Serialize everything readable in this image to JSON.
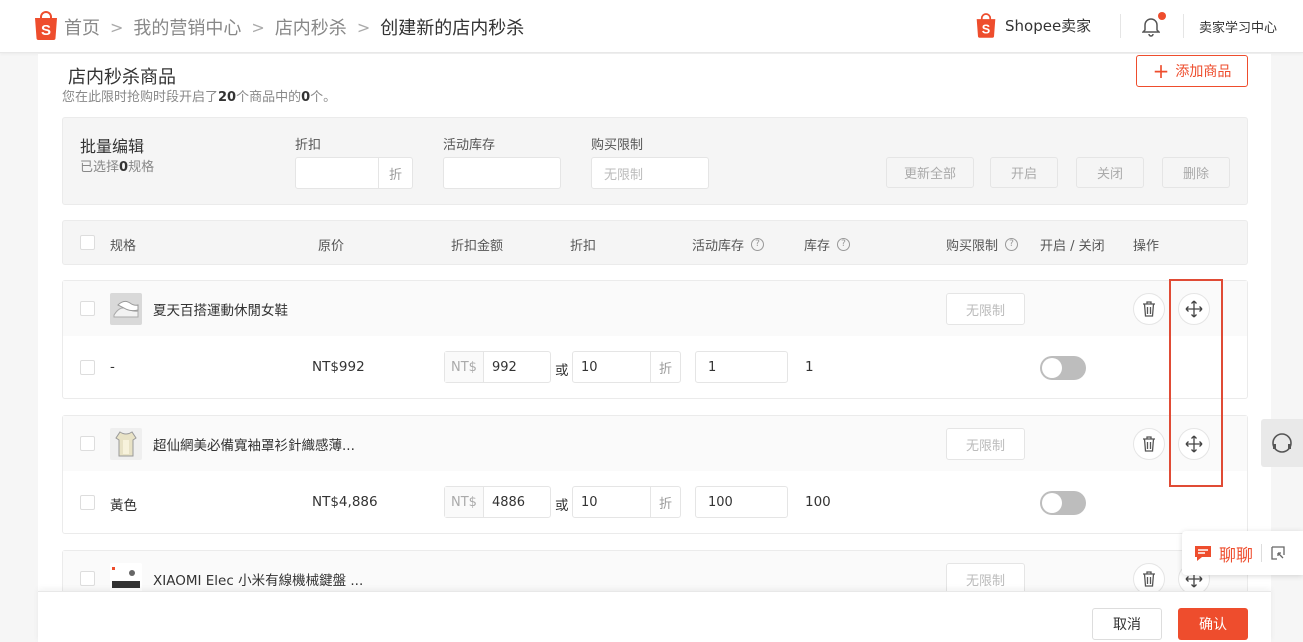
{
  "header": {
    "breadcrumb": [
      "首页",
      "我的营销中心",
      "店内秒杀",
      "创建新的店内秒杀"
    ],
    "brand": "Shopee卖家",
    "learning_center": "卖家学习中心"
  },
  "section": {
    "title": "店内秒杀商品",
    "subtitle_pre": "您在此限时抢购时段开启了",
    "subtitle_total": "20",
    "subtitle_mid": "个商品中的",
    "subtitle_enabled": "0",
    "subtitle_post": "个。",
    "add_button": "添加商品"
  },
  "bulk": {
    "title": "批量编辑",
    "selected_pre": "已选择",
    "selected_count": "0",
    "selected_post": "规格",
    "discount_label": "折扣",
    "discount_suffix": "折",
    "stock_label": "活动库存",
    "limit_label": "购买限制",
    "limit_placeholder": "无限制",
    "update_all": "更新全部",
    "enable": "开启",
    "disable": "关闭",
    "delete": "删除"
  },
  "table": {
    "columns": {
      "spec": "规格",
      "original_price": "原价",
      "discount_amount": "折扣金额",
      "discount": "折扣",
      "campaign_stock": "活动库存",
      "stock": "库存",
      "purchase_limit": "购买限制",
      "toggle": "开启 / 关闭",
      "actions": "操作"
    },
    "products": [
      {
        "name": "夏天百搭運動休閒女鞋",
        "limit": "无限制",
        "variant": {
          "name": "-",
          "price": "NT$992",
          "currency": "NT$",
          "discount_price": "992",
          "or": "或",
          "discount": "10",
          "discount_suffix": "折",
          "campaign_stock": "1",
          "stock": "1"
        }
      },
      {
        "name": "超仙網美必備寬袖罩衫針織感薄...",
        "limit": "无限制",
        "variant": {
          "name": "黃色",
          "price": "NT$4,886",
          "currency": "NT$",
          "discount_price": "4886",
          "or": "或",
          "discount": "10",
          "discount_suffix": "折",
          "campaign_stock": "100",
          "stock": "100"
        }
      },
      {
        "name": "XIAOMI Elec 小米有線機械鍵盤 ...",
        "limit": "无限制"
      }
    ]
  },
  "footer": {
    "cancel": "取消",
    "confirm": "确认"
  },
  "chat": {
    "label": "聊聊"
  },
  "colors": {
    "accent": "#ee4d2d",
    "highlight": "#e04b35"
  }
}
